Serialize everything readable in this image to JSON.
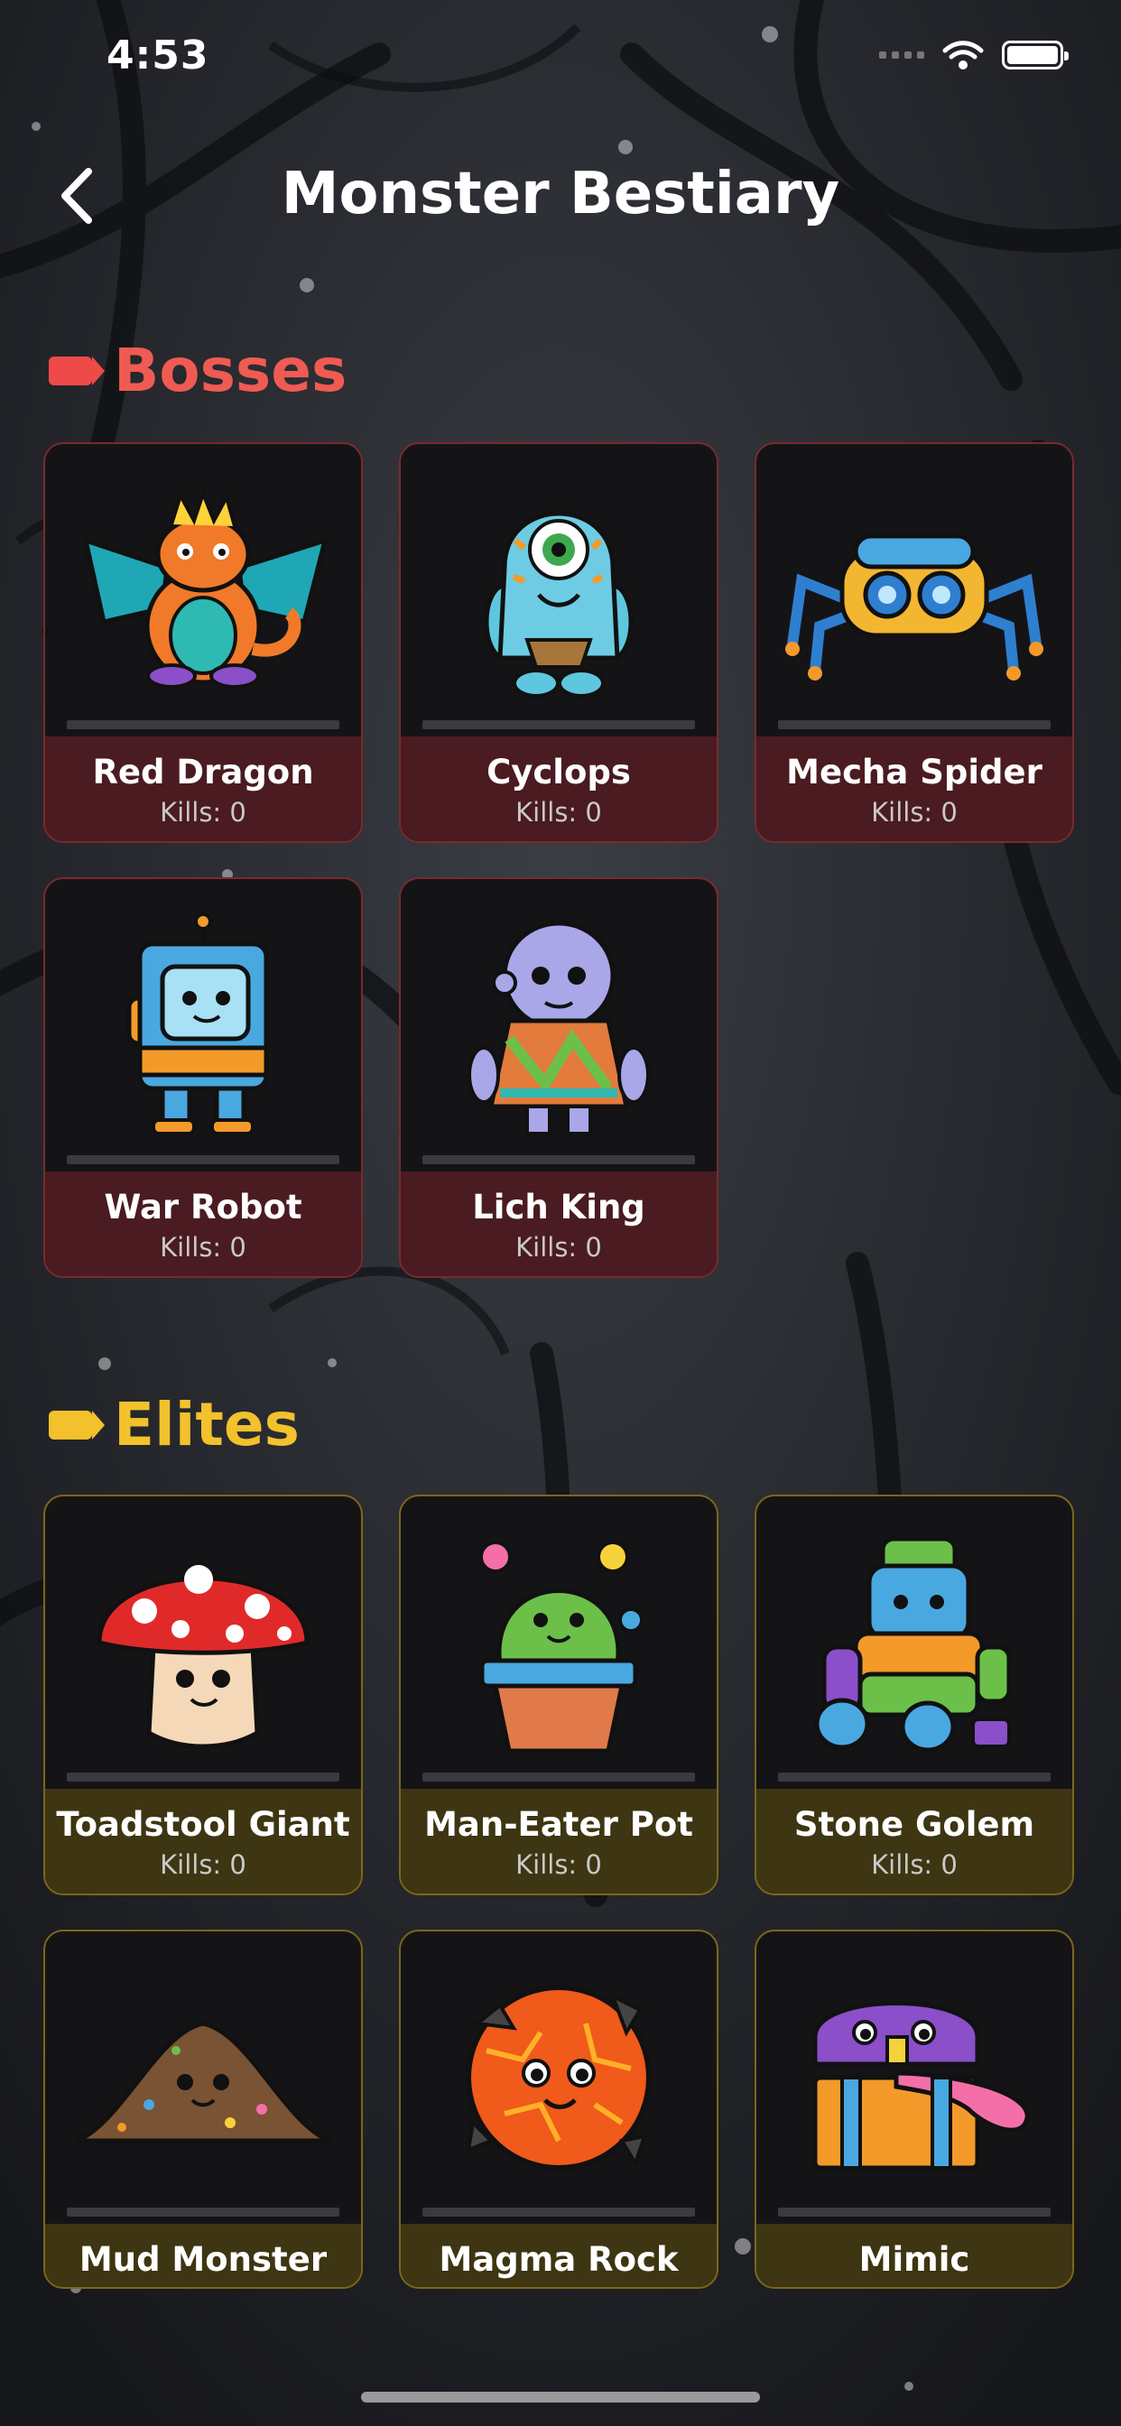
{
  "status_bar": {
    "time": "4:53"
  },
  "header": {
    "title": "Monster Bestiary"
  },
  "sections": [
    {
      "title": "Bosses",
      "color": "#ef5b52",
      "monsters": [
        {
          "name": "Red Dragon",
          "kills": "Kills: 0",
          "icon": "dragon-icon"
        },
        {
          "name": "Cyclops",
          "kills": "Kills: 0",
          "icon": "cyclops-icon"
        },
        {
          "name": "Mecha Spider",
          "kills": "Kills: 0",
          "icon": "mecha-spider-icon"
        },
        {
          "name": "War Robot",
          "kills": "Kills: 0",
          "icon": "robot-icon"
        },
        {
          "name": "Lich King",
          "kills": "Kills: 0",
          "icon": "lich-king-icon"
        }
      ]
    },
    {
      "title": "Elites",
      "color": "#f2c12c",
      "monsters": [
        {
          "name": "Toadstool Giant",
          "kills": "Kills: 0",
          "icon": "mushroom-icon"
        },
        {
          "name": "Man-Eater Pot",
          "kills": "Kills: 0",
          "icon": "potted-cactus-icon"
        },
        {
          "name": "Stone Golem",
          "kills": "Kills: 0",
          "icon": "golem-icon"
        },
        {
          "name": "Mud Monster",
          "kills": "",
          "icon": "mud-pile-icon"
        },
        {
          "name": "Magma Rock",
          "kills": "",
          "icon": "magma-rock-icon"
        },
        {
          "name": "Mimic",
          "kills": "",
          "icon": "treasure-chest-icon"
        }
      ]
    }
  ]
}
